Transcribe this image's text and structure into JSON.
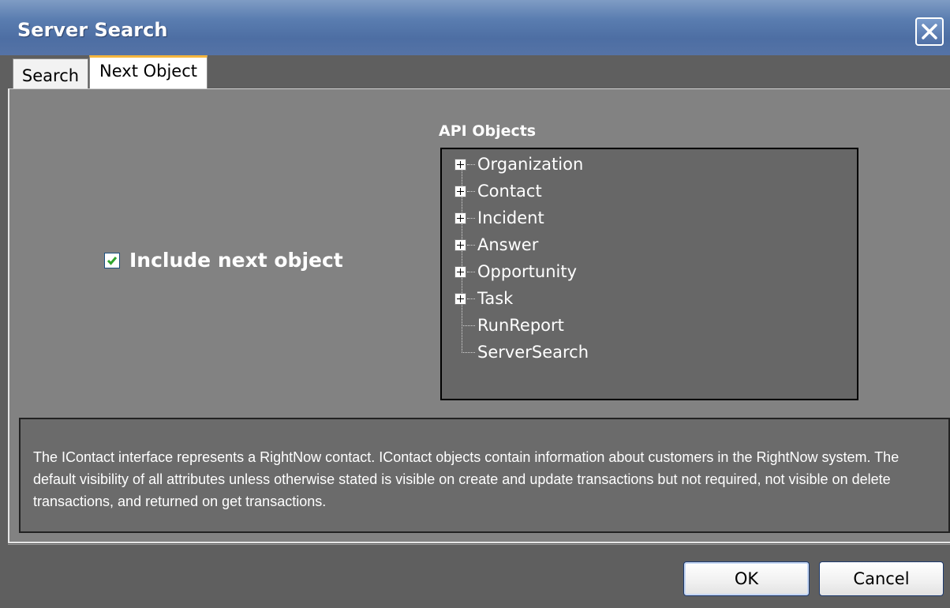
{
  "window": {
    "title": "Server Search"
  },
  "tabs": [
    {
      "label": "Search",
      "active": false
    },
    {
      "label": "Next Object",
      "active": true
    }
  ],
  "include_next": {
    "label": "Include next object",
    "checked": true
  },
  "api_objects": {
    "label": "API Objects",
    "items": [
      {
        "label": "Organization",
        "expandable": true
      },
      {
        "label": "Contact",
        "expandable": true
      },
      {
        "label": "Incident",
        "expandable": true
      },
      {
        "label": "Answer",
        "expandable": true
      },
      {
        "label": "Opportunity",
        "expandable": true
      },
      {
        "label": "Task",
        "expandable": true
      },
      {
        "label": "RunReport",
        "expandable": false
      },
      {
        "label": "ServerSearch",
        "expandable": false
      }
    ]
  },
  "description": {
    "text": "The IContact interface represents a RightNow contact. IContact objects contain information about customers in the RightNow system. The default visibility of all attributes unless otherwise stated is visible on create and update transactions but not required, not visible on delete transactions, and returned on get transactions."
  },
  "buttons": {
    "ok_label": "OK",
    "cancel_label": "Cancel"
  },
  "colors": {
    "titlebar": "#5a7db0",
    "active_tab_accent": "#f5b53d",
    "checkbox_check": "#2fa52f"
  }
}
